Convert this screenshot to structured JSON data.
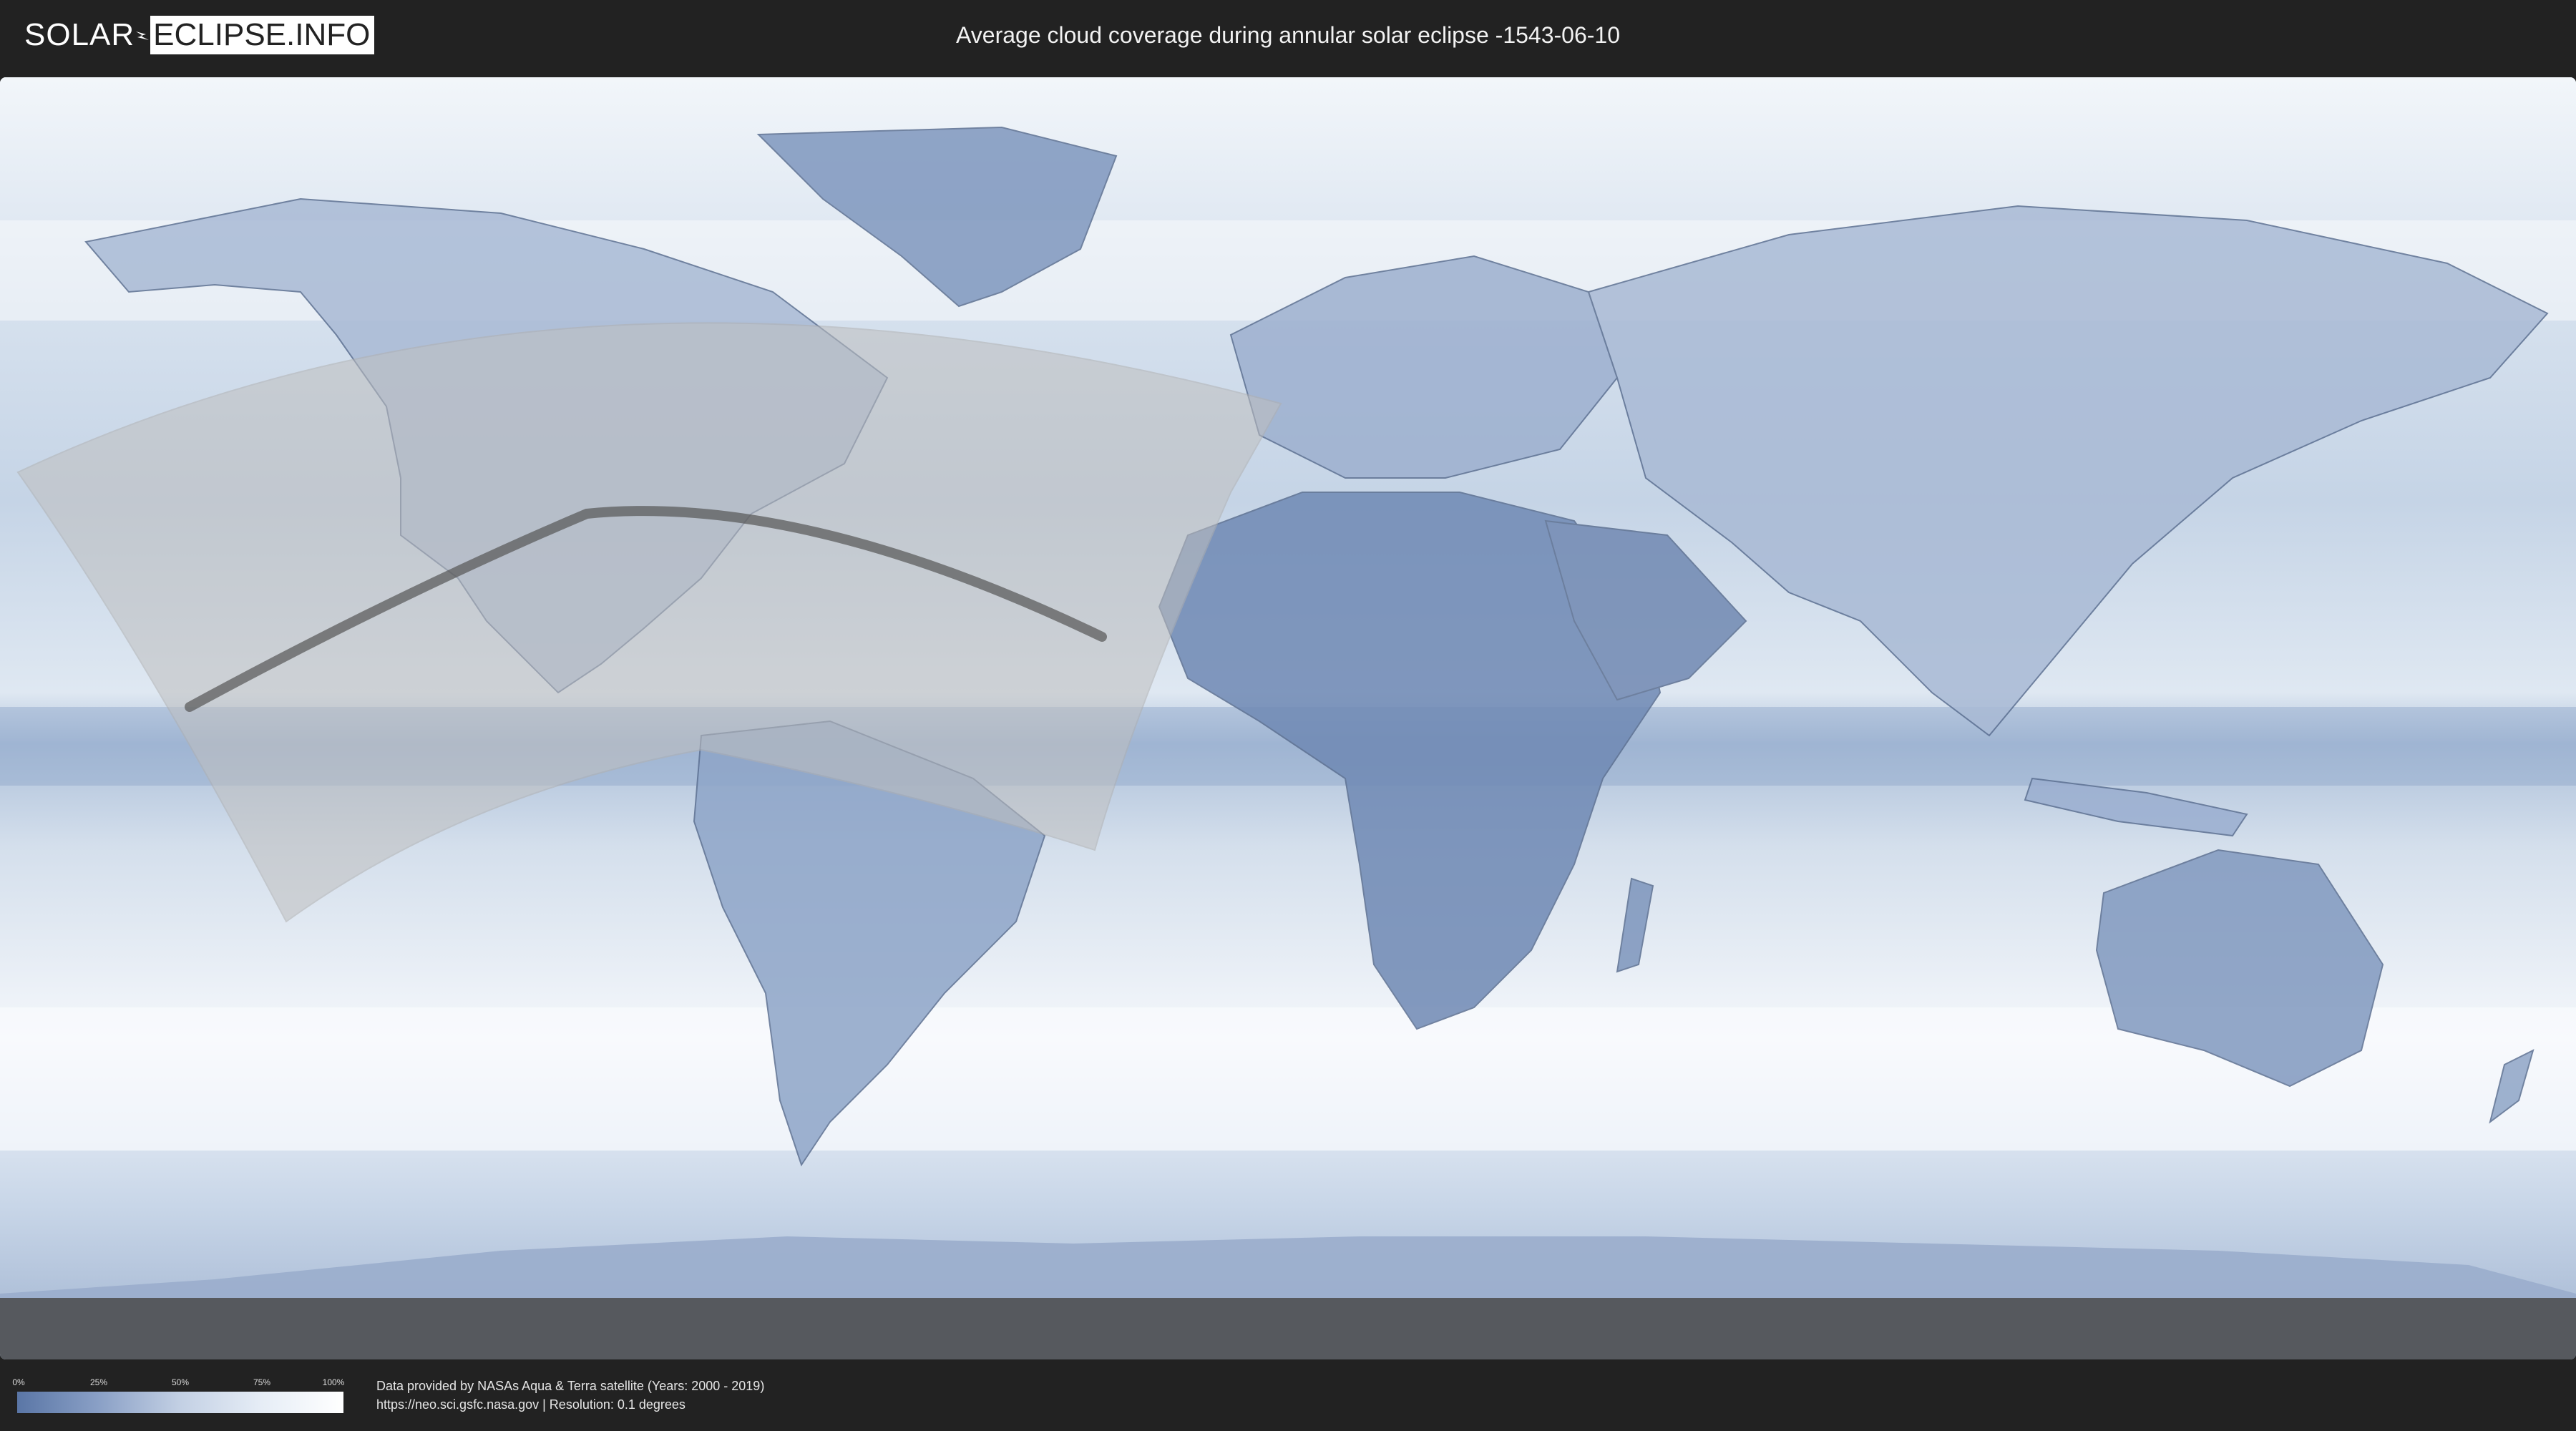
{
  "header": {
    "logo_left": "SOLAR",
    "logo_right": "ECLIPSE.INFO",
    "title": "Average cloud coverage during annular solar eclipse -1543-06-10"
  },
  "legend": {
    "ticks": [
      "0%",
      "25%",
      "50%",
      "75%",
      "100%"
    ],
    "gradient_colors": [
      "#5a76a6",
      "#8aa0c6",
      "#c3d0e4",
      "#e6edf6",
      "#ffffff"
    ]
  },
  "footer": {
    "credit_line1": "Data provided by NASAs Aqua & Terra satellite (Years: 2000 - 2019)",
    "credit_line2": "https://neo.sci.gsfc.nasa.gov | Resolution: 0.1 degrees"
  },
  "map": {
    "ocean_color": "#eef3f9",
    "land_color": "#7f97be",
    "eclipse_zone_color": "#bfbfbf",
    "central_line_color": "#555555"
  }
}
